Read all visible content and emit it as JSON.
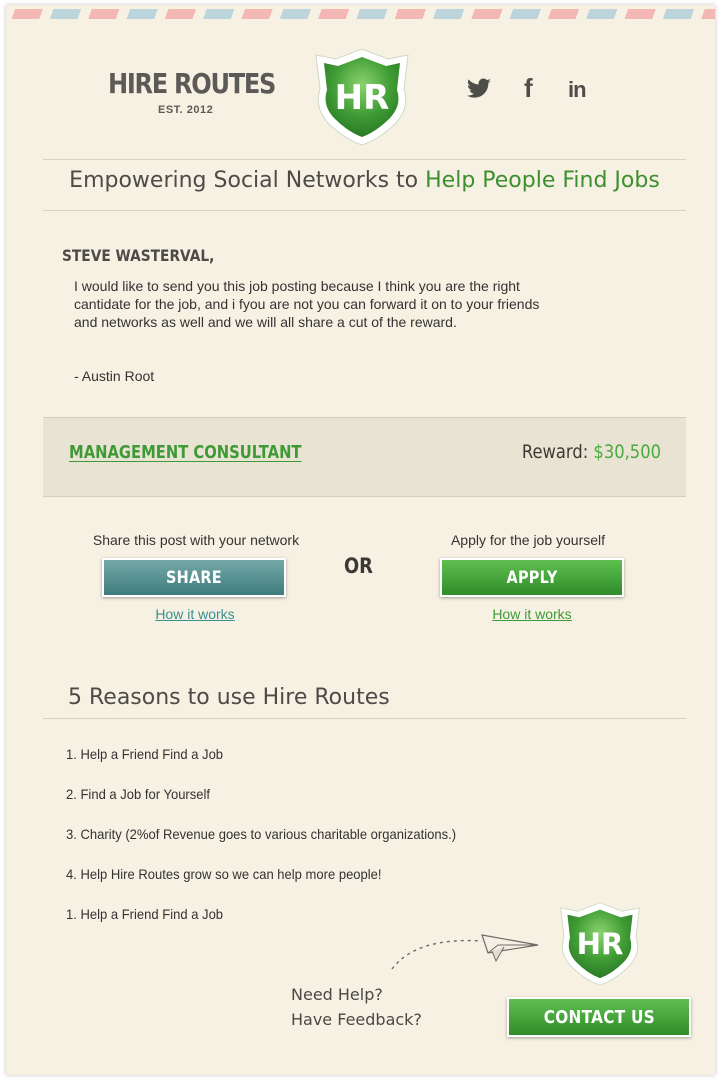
{
  "header": {
    "brand_name": "HIRE ROUTES",
    "brand_est": "EST. 2012",
    "logo_text": "HR",
    "social": {
      "twitter_icon": "twitter-bird-icon",
      "facebook_glyph": "f",
      "linkedin_glyph": "in"
    }
  },
  "tagline": {
    "lead": "Empowering Social Networks to ",
    "highlight": "Help People Find Jobs"
  },
  "letter": {
    "recipient": "STEVE WASTERVAL,",
    "body": "I would like to send you this job posting because I think you are the right cantidate for the job, and i fyou are not you can forward it on to your friends and networks as well and we will all share a cut of the reward.",
    "signature": "- Austin Root"
  },
  "job": {
    "title": "MANAGEMENT CONSULTANT",
    "reward_label": "Reward: ",
    "reward_amount": "$30,500"
  },
  "cta": {
    "share_caption": "Share this post with your network",
    "share_label": "SHARE",
    "share_link": "How it works",
    "or_label": "OR",
    "apply_caption": "Apply for the job yourself",
    "apply_label": "APPLY",
    "apply_link": "How it works"
  },
  "reasons": {
    "title": "5 Reasons to use Hire Routes",
    "items": [
      "1. Help a Friend Find a Job",
      "2. Find a Job for Yourself",
      "3. Charity (2%of Revenue goes to various charitable organizations.)",
      "4. Help Hire Routes grow so we can help more people!",
      "1. Help a Friend Find a Job"
    ]
  },
  "footer": {
    "help_line1": "Need Help?",
    "help_line2": "Have Feedback?",
    "contact_label": "CONTACT US",
    "logo_text": "HR"
  },
  "colors": {
    "background": "#f6f1e3",
    "brand_green": "#3d8f2f",
    "share_teal": "#4f8c8e",
    "job_band": "#e9e3d3"
  }
}
